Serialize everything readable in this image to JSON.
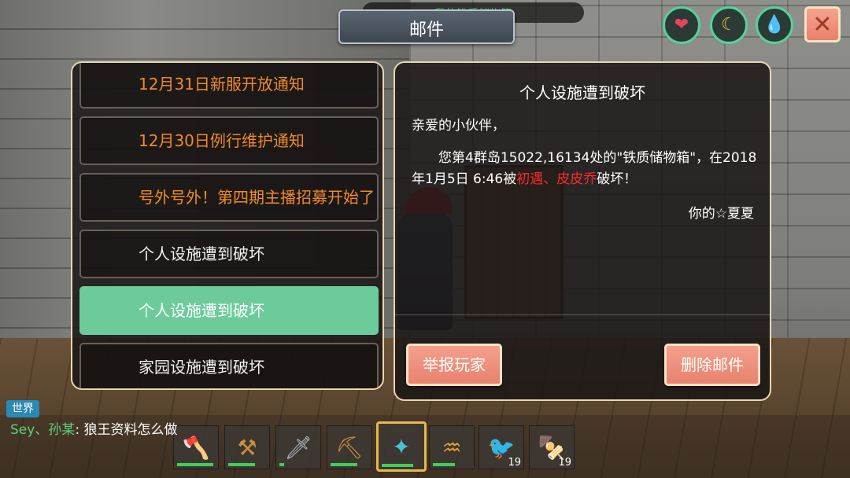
{
  "header": {
    "top_strip_text": "我的铁质储物箱",
    "title": "邮件"
  },
  "status_icons": [
    {
      "icon": "heart-icon",
      "color": "#e8445c"
    },
    {
      "icon": "banana-icon",
      "color": "#f0c43a"
    },
    {
      "icon": "water-drop-icon",
      "color": "#36c6e0"
    }
  ],
  "close_label": "✕",
  "mail_list": [
    {
      "title": "12月31日新服开放通知",
      "style": "orange"
    },
    {
      "title": "12月30日例行维护通知",
      "style": "orange"
    },
    {
      "title": "号外号外！第四期主播招募开始了",
      "style": "orange"
    },
    {
      "title": "个人设施遭到破坏",
      "style": "normal"
    },
    {
      "title": "个人设施遭到破坏",
      "style": "selected"
    },
    {
      "title": "家园设施遭到破坏",
      "style": "normal"
    }
  ],
  "mail_detail": {
    "title": "个人设施遭到破坏",
    "greeting": "亲爱的小伙伴，",
    "body_part1": "您第4群岛15022,16134处的\"铁质储物箱\"，在2018年1月5日 6:46被",
    "attackers": "初遇、皮皮乔",
    "body_part2": "破坏！",
    "signature": "你的☆夏夏",
    "report_button": "举报玩家",
    "delete_button": "删除邮件"
  },
  "chat": {
    "channel": "世界",
    "user": "Sey、孙某",
    "separator": ":",
    "message": "狼王资料怎么做"
  },
  "hotbar": [
    {
      "item": "axe-icon",
      "count": "",
      "durability": 0.8
    },
    {
      "item": "club-icon",
      "count": "",
      "durability": 0.6
    },
    {
      "item": "sword-icon",
      "count": "",
      "durability": 0.1
    },
    {
      "item": "pickaxe-icon",
      "count": "",
      "durability": 0.6
    },
    {
      "item": "staff-icon",
      "count": "",
      "durability": 0.7
    },
    {
      "item": "horn-icon",
      "count": "",
      "durability": 0.5
    },
    {
      "item": "bird-figure-icon",
      "count": "19",
      "durability": 0
    },
    {
      "item": "skewer-icon",
      "count": "19",
      "durability": 0
    }
  ]
}
